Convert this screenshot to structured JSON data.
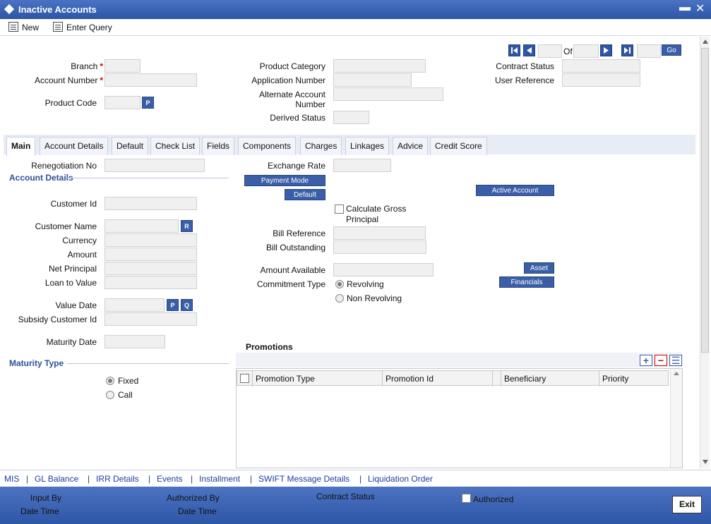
{
  "window": {
    "title": "Inactive Accounts",
    "minimize": "▬",
    "close": "✕"
  },
  "toolbar": {
    "new_label": "New",
    "enter_query_label": "Enter Query"
  },
  "nav": {
    "of_label": "Of",
    "go_label": "Go"
  },
  "header": {
    "branch_label": "Branch",
    "account_number_label": "Account Number",
    "product_code_label": "Product Code",
    "product_category_label": "Product Category",
    "application_number_label": "Application Number",
    "alternate_account_label_1": "Alternate Account",
    "alternate_account_label_2": "Number",
    "derived_status_label": "Derived Status",
    "contract_status_label": "Contract Status",
    "user_reference_label": "User Reference",
    "required_mark": "*",
    "p_btn": "P"
  },
  "tabs": [
    {
      "label": "Main"
    },
    {
      "label": "Account Details"
    },
    {
      "label": "Default"
    },
    {
      "label": "Check List"
    },
    {
      "label": "Fields"
    },
    {
      "label": "Components"
    },
    {
      "label": "Charges"
    },
    {
      "label": "Linkages"
    },
    {
      "label": "Advice"
    },
    {
      "label": "Credit Score"
    }
  ],
  "main": {
    "renegotiation_no_label": "Renegotiation No",
    "account_details_title": "Account Details",
    "customer_id_label": "Customer Id",
    "customer_name_label": "Customer Name",
    "currency_label": "Currency",
    "amount_label": "Amount",
    "net_principal_label": "Net Principal",
    "loan_to_value_label": "Loan to Value",
    "value_date_label": "Value Date",
    "subsidy_customer_id_label": "Subsidy Customer Id",
    "maturity_date_label": "Maturity Date",
    "maturity_type_title": "Maturity Type",
    "fixed_label": "Fixed",
    "call_label": "Call",
    "r_btn": "R",
    "p_btn": "P",
    "q_btn": "Q",
    "exchange_rate_label": "Exchange Rate",
    "payment_mode_btn": "Payment Mode",
    "default_btn": "Default",
    "active_account_btn": "Active Account",
    "calculate_gross_label_1": "Calculate Gross",
    "calculate_gross_label_2": "Principal",
    "bill_reference_label": "Bill Reference",
    "bill_outstanding_label": "Bill Outstanding",
    "amount_available_label": "Amount Available",
    "commitment_type_label": "Commitment Type",
    "revolving_label": "Revolving",
    "non_revolving_label": "Non Revolving",
    "asset_btn": "Asset",
    "financials_btn": "Financials"
  },
  "promotions": {
    "title": "Promotions",
    "columns": [
      "Promotion Type",
      "Promotion Id",
      "Beneficiary",
      "Priority"
    ]
  },
  "links": [
    "MIS",
    "GL Balance",
    "IRR Details",
    "Events",
    "Installment",
    "SWIFT Message Details",
    "Liquidation Order"
  ],
  "link_separator": "|",
  "footer": {
    "input_by_label": "Input By",
    "date_time_label": "Date Time",
    "authorized_by_label": "Authorized By",
    "date_time_label_2": "Date Time",
    "contract_status_label": "Contract Status",
    "authorized_label": "Authorized",
    "exit_label": "Exit"
  },
  "colors": {
    "titlebar": "#2d55a6",
    "button": "#3a5fa8",
    "link": "#1f3f99",
    "footer": "#2e56a7"
  }
}
